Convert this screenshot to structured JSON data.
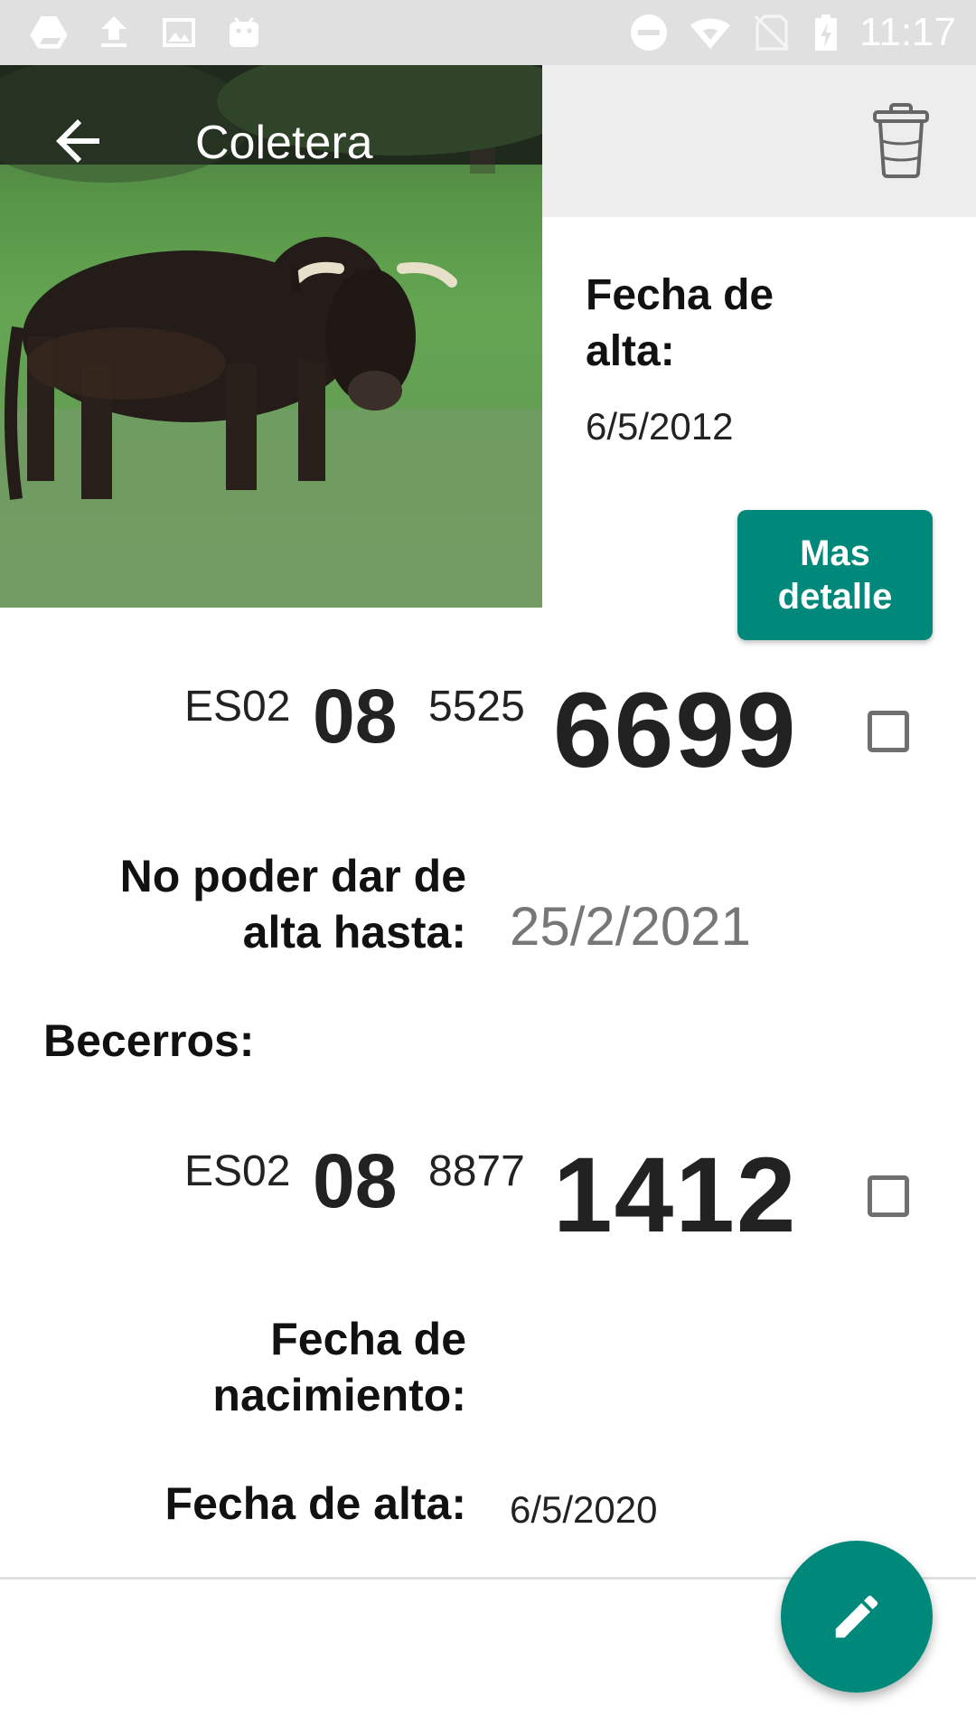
{
  "status_bar": {
    "time": "11:17",
    "left_icons": [
      "drive-icon",
      "upload-icon",
      "image-icon",
      "android-icon"
    ],
    "right_icons": [
      "do-not-disturb-icon",
      "wifi-icon",
      "no-sim-icon",
      "battery-charging-icon"
    ]
  },
  "header": {
    "title": "Coletera",
    "back_icon": "arrow-back-icon",
    "delete_icon": "trash-icon"
  },
  "photo": {
    "subject": "cow-photo"
  },
  "summary": {
    "date_label": "Fecha de alta:",
    "date_value": "6/5/2012",
    "detail_button": "Mas detalle"
  },
  "animal_id": {
    "country": "ES02",
    "province": "08",
    "code": "5525",
    "number": "6699"
  },
  "restriction": {
    "label": "No poder dar de alta hasta:",
    "value": "25/2/2021"
  },
  "calves": {
    "section_label": "Becerros:",
    "items": [
      {
        "country": "ES02",
        "province": "08",
        "code": "8877",
        "number": "1412",
        "birth_label": "Fecha de nacimiento:",
        "birth_value": "",
        "registration_label": "Fecha de alta:",
        "registration_value": "6/5/2020"
      }
    ]
  },
  "fab": {
    "icon": "edit-pencil-icon"
  },
  "colors": {
    "accent": "#00897b",
    "status_bar": "#e0e0e0",
    "toolbar_gray": "#ededed"
  }
}
